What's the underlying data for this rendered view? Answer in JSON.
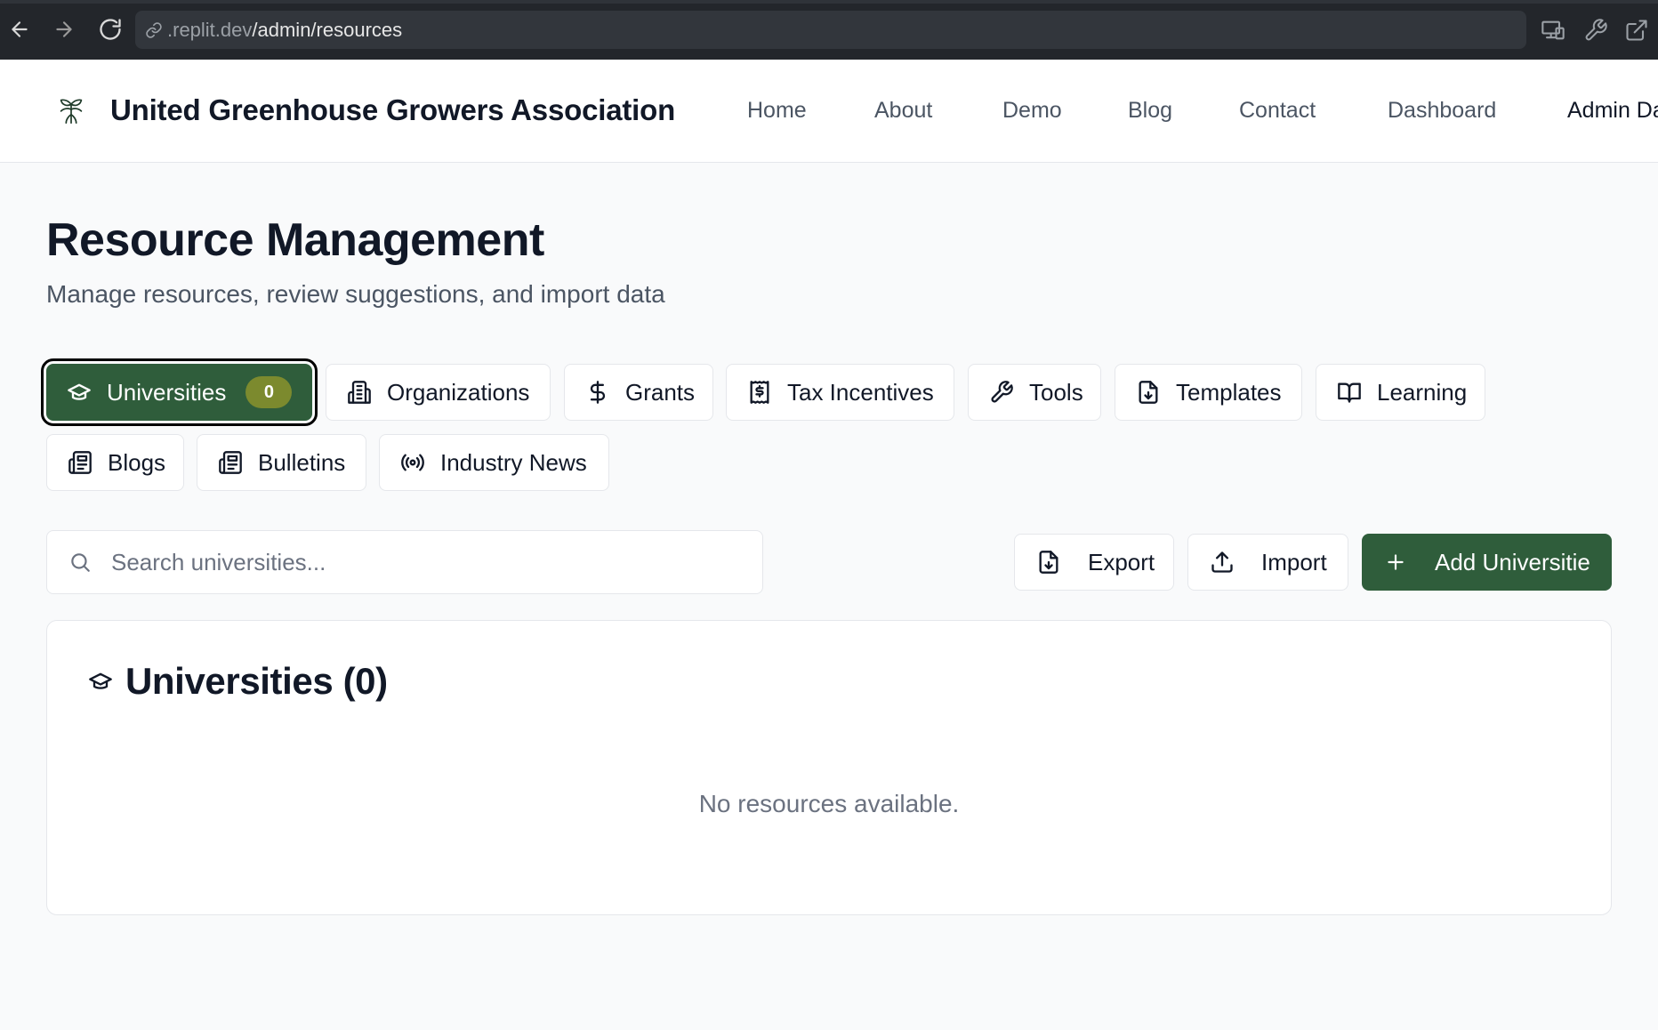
{
  "browser": {
    "url_host": ".replit.dev",
    "url_path": "/admin/resources"
  },
  "header": {
    "brand": "United Greenhouse Growers Association",
    "nav": [
      {
        "label": "Home"
      },
      {
        "label": "About"
      },
      {
        "label": "Demo"
      },
      {
        "label": "Blog"
      },
      {
        "label": "Contact"
      },
      {
        "label": "Dashboard"
      },
      {
        "label": "Admin Da"
      }
    ]
  },
  "page": {
    "title": "Resource Management",
    "subtitle": "Manage resources, review suggestions, and import data"
  },
  "tabs": [
    {
      "label": "Universities",
      "icon": "graduation-cap-icon",
      "badge": "0",
      "active": true
    },
    {
      "label": "Organizations",
      "icon": "building-icon"
    },
    {
      "label": "Grants",
      "icon": "dollar-icon"
    },
    {
      "label": "Tax Incentives",
      "icon": "receipt-icon"
    },
    {
      "label": "Tools",
      "icon": "wrench-icon"
    },
    {
      "label": "Templates",
      "icon": "file-download-icon"
    },
    {
      "label": "Learning",
      "icon": "book-open-icon"
    },
    {
      "label": "Blogs",
      "icon": "newspaper-icon"
    },
    {
      "label": "Bulletins",
      "icon": "newspaper-icon"
    },
    {
      "label": "Industry News",
      "icon": "radio-icon"
    }
  ],
  "search": {
    "placeholder": "Search universities...",
    "value": ""
  },
  "actions": {
    "export_label": "Export",
    "import_label": "Import",
    "add_label": "Add Universitie"
  },
  "list": {
    "title": "Universities (0)",
    "empty_message": "No resources available."
  },
  "colors": {
    "primary": "#2f5d3b",
    "badge": "#7c8a2e",
    "text": "#111827",
    "muted": "#4b5563"
  }
}
